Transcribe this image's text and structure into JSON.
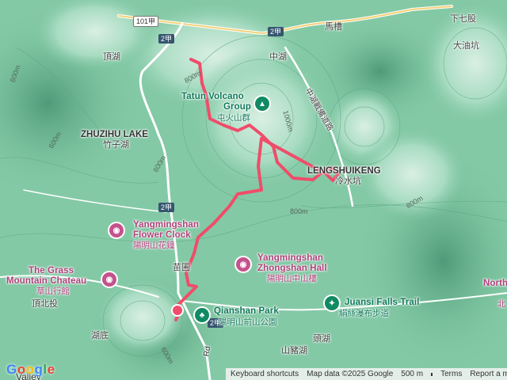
{
  "map": {
    "road_shields": [
      "101甲",
      "2甲",
      "2甲",
      "2甲",
      "2甲"
    ],
    "places": [
      {
        "id": "dingpinghu",
        "zh": "頂湖"
      },
      {
        "id": "zhonghu",
        "zh": "中湖"
      },
      {
        "id": "macao",
        "zh": "馬槽"
      },
      {
        "id": "xiaqigu",
        "zh": "下七股"
      },
      {
        "id": "dayoukeng",
        "zh": "大油坑"
      },
      {
        "id": "zhuzihu",
        "en": "ZHUZIHU LAKE",
        "zh": "竹子湖"
      },
      {
        "id": "lengshuikeng",
        "en": "LENGSHUIKENG",
        "zh": "冷水坑"
      },
      {
        "id": "miaopu",
        "zh": "苗圃"
      },
      {
        "id": "dingbeitou",
        "zh": "頂北投"
      },
      {
        "id": "hudi",
        "zh": "湖底"
      },
      {
        "id": "touhu",
        "zh": "頭湖"
      },
      {
        "id": "shanzhuhu",
        "zh": "山豬湖"
      },
      {
        "id": "valley",
        "en": "Valley"
      }
    ],
    "road_names": [
      "中湖戰備道路",
      "Rd"
    ],
    "elevations": [
      "600m",
      "600m",
      "600m",
      "800m",
      "1000m",
      "800m",
      "800m",
      "600m"
    ],
    "pois": [
      {
        "id": "tatun",
        "en_1": "Tatun Volcano",
        "en_2": "Group",
        "zh": "屯火山群",
        "icon": "mountain-icon",
        "color": "#0f8a62"
      },
      {
        "id": "flowerclock",
        "en_1": "Yangmingshan",
        "en_2": "Flower Clock",
        "zh": "陽明山花鐘",
        "icon": "camera-icon",
        "color": "#c4528c"
      },
      {
        "id": "grassmountain",
        "en_1": "The Grass",
        "en_2": "Mountain Chateau",
        "zh": "草山行館",
        "icon": "camera-icon",
        "color": "#c4528c"
      },
      {
        "id": "zhongshanhall",
        "en_1": "Yangmingshan",
        "en_2": "Zhongshan Hall",
        "zh": "陽明山中山樓",
        "icon": "camera-icon",
        "color": "#c4528c"
      },
      {
        "id": "qianshan",
        "en_1": "Qianshan Park",
        "zh": "陽明山前山公園",
        "icon": "tree-icon",
        "color": "#0f8a62"
      },
      {
        "id": "juansi",
        "en_1": "Juansi Falls Trail",
        "zh": "絹絲瀑布步道",
        "icon": "hiker-icon",
        "color": "#0f8a62"
      },
      {
        "id": "north",
        "en_1": "North",
        "zh": "北"
      }
    ],
    "route_color": "#ef4d6a"
  },
  "footer": {
    "shortcuts": "Keyboard shortcuts",
    "attribution": "Map data ©2025 Google",
    "scale": "500 m",
    "terms": "Terms",
    "report": "Report a map error"
  },
  "logo": {
    "letters": [
      "G",
      "o",
      "o",
      "g",
      "l",
      "e"
    ]
  }
}
